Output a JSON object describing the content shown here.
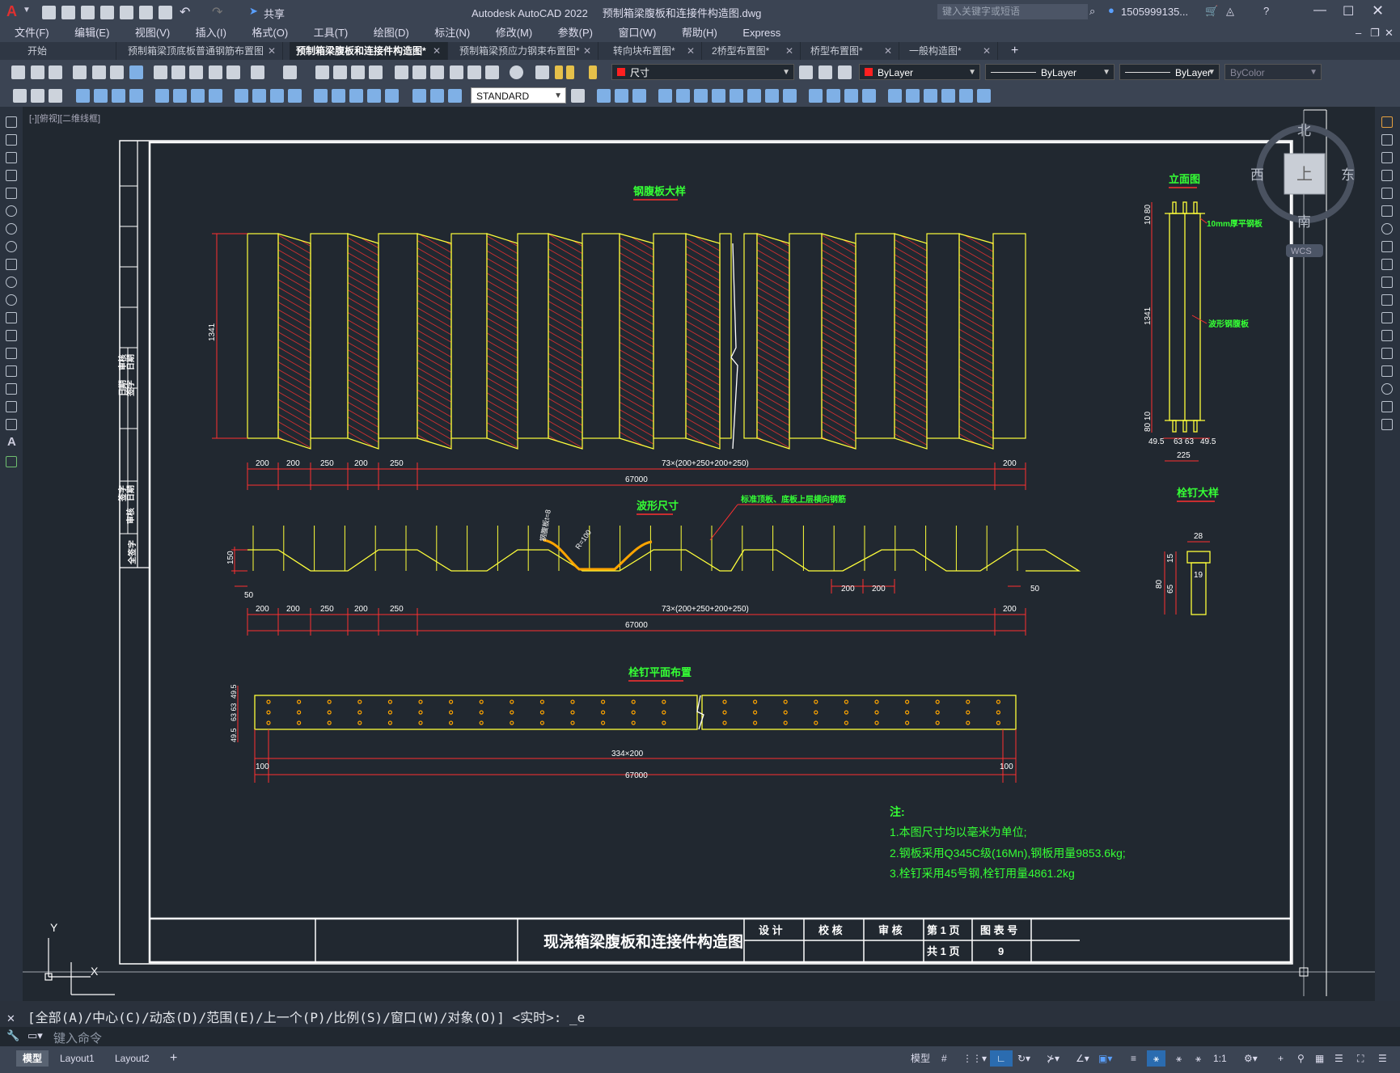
{
  "app": {
    "title": "Autodesk AutoCAD 2022",
    "document": "预制箱梁腹板和连接件构造图.dwg",
    "search_placeholder": "键入关键字或短语",
    "user": "1505999135...",
    "share": "共享"
  },
  "menu": [
    "文件(F)",
    "编辑(E)",
    "视图(V)",
    "插入(I)",
    "格式(O)",
    "工具(T)",
    "绘图(D)",
    "标注(N)",
    "修改(M)",
    "参数(P)",
    "窗口(W)",
    "帮助(H)",
    "Express"
  ],
  "tabs": [
    {
      "label": "开始",
      "closable": false
    },
    {
      "label": "预制箱梁顶底板普通钢筋布置图",
      "closable": true
    },
    {
      "label": "预制箱梁腹板和连接件构造图*",
      "closable": true,
      "active": true
    },
    {
      "label": "预制箱梁预应力钢束布置图*",
      "closable": true
    },
    {
      "label": "转向块布置图*",
      "closable": true
    },
    {
      "label": "2桥型布置图*",
      "closable": true
    },
    {
      "label": "桥型布置图*",
      "closable": true
    },
    {
      "label": "一般构造图*",
      "closable": true
    }
  ],
  "toolbar": {
    "layer": "尺寸",
    "color": "ByLayer",
    "linetype": "ByLayer",
    "lineweight": "ByLayer",
    "plotstyle": "ByColor",
    "textstyle": "STANDARD"
  },
  "viewport_label": "[-][俯视][二维线框]",
  "viewcube": {
    "north": "北",
    "south": "南",
    "east": "东",
    "west": "西",
    "face": "上",
    "wcs": "WCS"
  },
  "drawing": {
    "titles": {
      "web_detail": "钢腹板大样",
      "elevation": "立面图",
      "wave": "波形尺寸",
      "stud_detail": "栓钉大样",
      "stud_layout": "栓钉平面布置"
    },
    "dims": {
      "seg200": "200",
      "seg250": "250",
      "repeat": "73×(200+250+200+250)",
      "total": "67000",
      "height": "1341",
      "wave_h": "150",
      "wave_50": "50",
      "stud_repeat": "334×200",
      "stud_100": "100",
      "stud_rows_a": "49.5",
      "stud_rows_b": "63 63",
      "elev_top": "10 80",
      "elev_bot": "80 10",
      "elev_w1": "49.5",
      "elev_w2": "63 63",
      "elev_total": "225",
      "stud_28": "28",
      "stud_15": "15",
      "stud_65": "65",
      "stud_80": "80",
      "stud_19": "19",
      "wave_t": "钢腹板t=8",
      "wave_r": "R=100"
    },
    "labels": {
      "plate10": "10mm厚平钢板",
      "corrugated": "波形钢腹板",
      "wave_note": "标准顶板、底板上层横向钢筋"
    },
    "notes": [
      "注:",
      "1.本图尺寸均以毫米为单位;",
      "2.钢板采用Q345C级(16Mn),钢板用量9853.6kg;",
      "3.栓钉采用45号钢,栓钉用量4861.2kg"
    ],
    "titleblock": {
      "title": "现浇箱梁腹板和连接件构造图",
      "design": "设 计",
      "check": "校 核",
      "review": "审 核",
      "page": "第 1 页",
      "total": "共 1 页",
      "dwgno_label": "图 表 号",
      "dwgno": "9"
    },
    "stamp": [
      "日期",
      "审核",
      "签字",
      "日期",
      "日期",
      "签字",
      "审核",
      "签字",
      "日期",
      "签字",
      "全签字"
    ]
  },
  "command": {
    "history": "[全部(A)/中心(C)/动态(D)/范围(E)/上一个(P)/比例(S)/窗口(W)/对象(O)] <实时>: _e",
    "placeholder": "键入命令"
  },
  "status": {
    "model_tab": "模型",
    "layouts": [
      "Layout1",
      "Layout2"
    ],
    "model_label": "模型",
    "scale": "1:1"
  },
  "colors": {
    "bg": "#212830",
    "yellow": "#ffff3a",
    "red": "#ff3030",
    "green": "#35ff35",
    "white": "#ffffff"
  }
}
